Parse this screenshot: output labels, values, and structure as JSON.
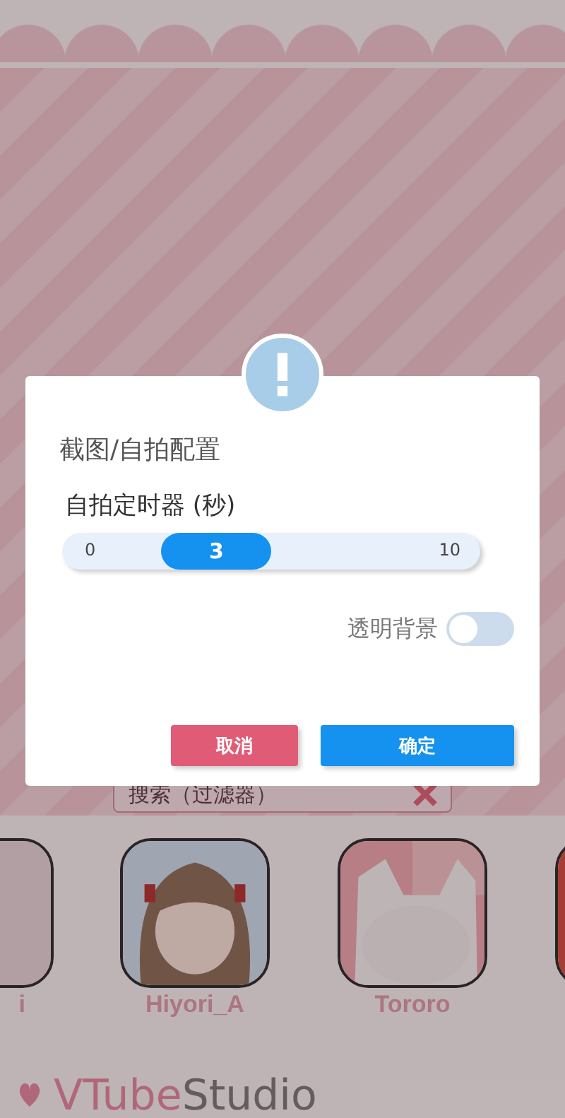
{
  "background": {
    "search": {
      "placeholder": "搜索（过滤器）"
    },
    "models": [
      {
        "name": "i",
        "kind": "blackcat"
      },
      {
        "name": "Hiyori_A",
        "kind": "girl"
      },
      {
        "name": "Tororo",
        "kind": "whitecat"
      },
      {
        "kind": "red"
      }
    ],
    "logo": {
      "brand": "VTube",
      "product": "Studio"
    }
  },
  "dialog": {
    "title": "截图/自拍配置",
    "slider": {
      "label": "自拍定时器 (秒)",
      "min": "0",
      "max": "10",
      "reading": "3",
      "level": 0.3
    },
    "toggle": {
      "label": "透明背景",
      "on": false
    },
    "buttons": [
      {
        "label": "取消",
        "kind": "cancel"
      },
      {
        "label": "确定",
        "kind": "confirm"
      }
    ]
  }
}
